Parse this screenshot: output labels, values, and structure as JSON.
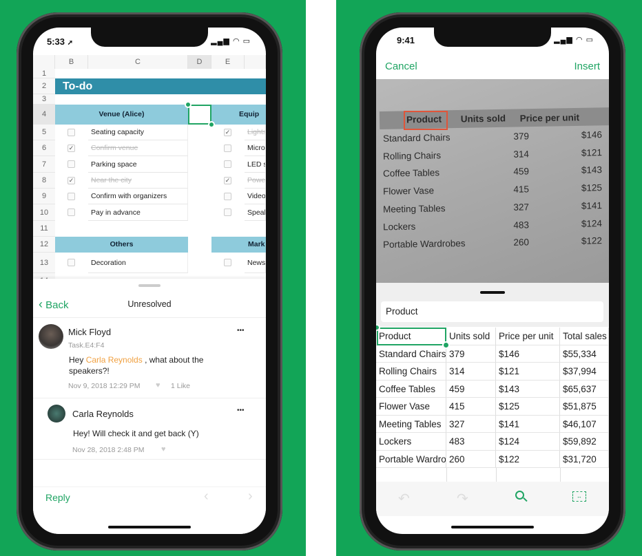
{
  "colors": {
    "background": "#12a557",
    "accent": "#1fa463",
    "mention": "#f0a040",
    "header_band": "#2f8ea8",
    "sub_band": "#8ecbdc"
  },
  "left": {
    "status": {
      "time": "5:33",
      "location_icon": "location-arrow-icon",
      "signal": "signal-wifi-battery"
    },
    "sheet": {
      "columns": [
        "B",
        "C",
        "D",
        "E"
      ],
      "rows": [
        "1",
        "2",
        "3",
        "4",
        "5",
        "6",
        "7",
        "8",
        "9",
        "10",
        "11",
        "12",
        "13",
        "14"
      ],
      "title": "To-do",
      "section1": "Venue (Alice)",
      "section2": "Equip",
      "section3": "Others",
      "section4": "Mark",
      "items_c": [
        {
          "t": "Seating capacity",
          "done": false
        },
        {
          "t": "Confirm venue",
          "done": true
        },
        {
          "t": "Parking space",
          "done": false
        },
        {
          "t": "Near the city",
          "done": true
        },
        {
          "t": "Confirm with organizers",
          "done": false
        },
        {
          "t": "Pay in advance",
          "done": false
        }
      ],
      "items_f": [
        {
          "t": "Lights",
          "done": true
        },
        {
          "t": "Microp",
          "done": false
        },
        {
          "t": "LED s",
          "done": false
        },
        {
          "t": "Power",
          "done": true
        },
        {
          "t": "Videos",
          "done": false
        },
        {
          "t": "Speak",
          "done": false
        }
      ],
      "row13_c": "Decoration",
      "row13_f": "Newsp"
    },
    "comments": {
      "back": "Back",
      "title": "Unresolved",
      "c1": {
        "author": "Mick Floyd",
        "ref": "Task.E4:F4",
        "pre": "Hey ",
        "mention": "Carla Reynolds",
        "post": " , what about the speakers?!",
        "date": "Nov 9, 2018 12:29 PM",
        "likes": "1 Like"
      },
      "c2": {
        "author": "Carla Reynolds",
        "text": "Hey! Will check it and get back (Y)",
        "date": "Nov 28, 2018 2:48 PM"
      },
      "more": "•••",
      "reply": "Reply"
    }
  },
  "right": {
    "status": {
      "time": "9:41"
    },
    "cancel": "Cancel",
    "insert": "Insert",
    "photo": {
      "headers": [
        "Product",
        "Units sold",
        "Price per unit"
      ],
      "rows": [
        [
          "Standard Chairs",
          "379",
          "$146"
        ],
        [
          "Rolling Chairs",
          "314",
          "$121"
        ],
        [
          "Coffee Tables",
          "459",
          "$143"
        ],
        [
          "Flower Vase",
          "415",
          "$125"
        ],
        [
          "Meeting Tables",
          "327",
          "$141"
        ],
        [
          "Lockers",
          "483",
          "$124"
        ],
        [
          "Portable Wardrobes",
          "260",
          "$122"
        ]
      ]
    },
    "input_value": "Product",
    "table": {
      "headers": [
        "Product",
        "Units sold",
        "Price per unit",
        "Total sales"
      ],
      "rows": [
        [
          "Standard Chairs",
          "379",
          "$146",
          "$55,334"
        ],
        [
          "Rolling Chairs",
          "314",
          "$121",
          "$37,994"
        ],
        [
          "Coffee Tables",
          "459",
          "$143",
          "$65,637"
        ],
        [
          "Flower Vase",
          "415",
          "$125",
          "$51,875"
        ],
        [
          "Meeting Tables",
          "327",
          "$141",
          "$46,107"
        ],
        [
          "Lockers",
          "483",
          "$124",
          "$59,892"
        ],
        [
          "Portable Wardrobes",
          "260",
          "$122",
          "$31,720"
        ]
      ]
    },
    "toolbar": [
      "undo-icon",
      "redo-icon",
      "search-icon",
      "fit-width-icon"
    ]
  }
}
